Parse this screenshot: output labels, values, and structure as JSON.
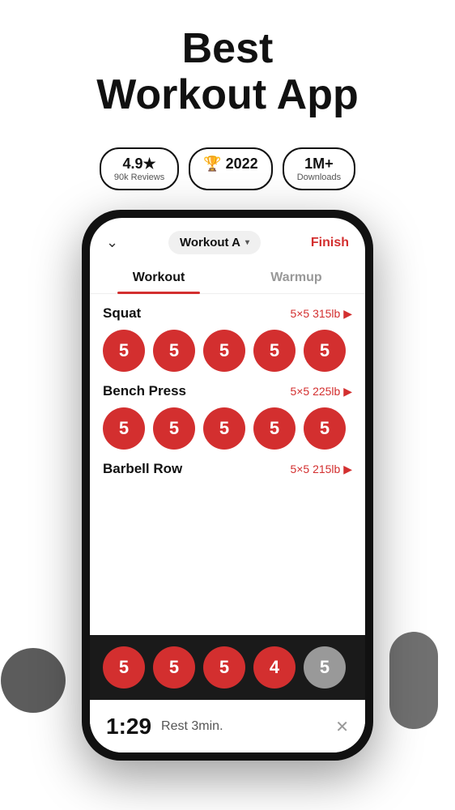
{
  "hero": {
    "title_line1": "Best",
    "title_line2": "Workout App"
  },
  "badges": [
    {
      "main": "4.9★",
      "sub": "90k Reviews"
    },
    {
      "main": "🏆 2022",
      "sub": ""
    },
    {
      "main": "1M+",
      "sub": "Downloads"
    }
  ],
  "app": {
    "chevron": "⌄",
    "workout_selector": "Workout A",
    "selector_arrow": "▾",
    "finish_label": "Finish",
    "tabs": [
      {
        "label": "Workout",
        "active": true
      },
      {
        "label": "Warmup",
        "active": false
      }
    ],
    "exercises": [
      {
        "name": "Squat",
        "spec": "5×5 315lb ▶",
        "sets": [
          5,
          5,
          5,
          5,
          5
        ],
        "active_count": 5
      },
      {
        "name": "Bench Press",
        "spec": "5×5 225lb ▶",
        "sets": [
          5,
          5,
          5,
          5,
          5
        ],
        "active_count": 5
      },
      {
        "name": "Barbell Row",
        "spec": "5×5 215lb ▶",
        "sets": [
          5,
          5,
          5,
          4,
          5
        ],
        "active_count": 4
      }
    ],
    "bottom_sets": [
      5,
      5,
      5,
      4,
      5
    ],
    "bottom_active_count": 4,
    "timer": {
      "time": "1:29",
      "label": "Rest 3min.",
      "close": "✕"
    }
  }
}
